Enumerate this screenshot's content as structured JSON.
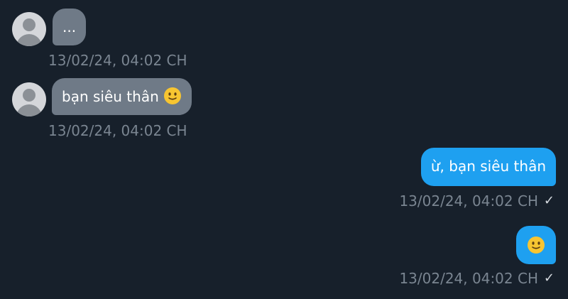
{
  "messages": [
    {
      "direction": "incoming",
      "text": "...",
      "timestamp": "13/02/24, 04:02 CH"
    },
    {
      "direction": "incoming",
      "text": "bạn siêu thân",
      "emoji": "slightly-smiling-face",
      "timestamp": "13/02/24, 04:02 CH"
    },
    {
      "direction": "outgoing",
      "text": "ừ, bạn siêu thân",
      "timestamp": "13/02/24, 04:02 CH",
      "status": "✓"
    },
    {
      "direction": "outgoing",
      "text": "",
      "emoji": "slightly-smiling-face",
      "timestamp": "13/02/24, 04:02 CH",
      "status": "✓"
    }
  ],
  "colors": {
    "background": "#17202b",
    "incoming_bubble": "#6f7a87",
    "outgoing_bubble": "#1ea0f0",
    "timestamp": "#7a8591"
  }
}
